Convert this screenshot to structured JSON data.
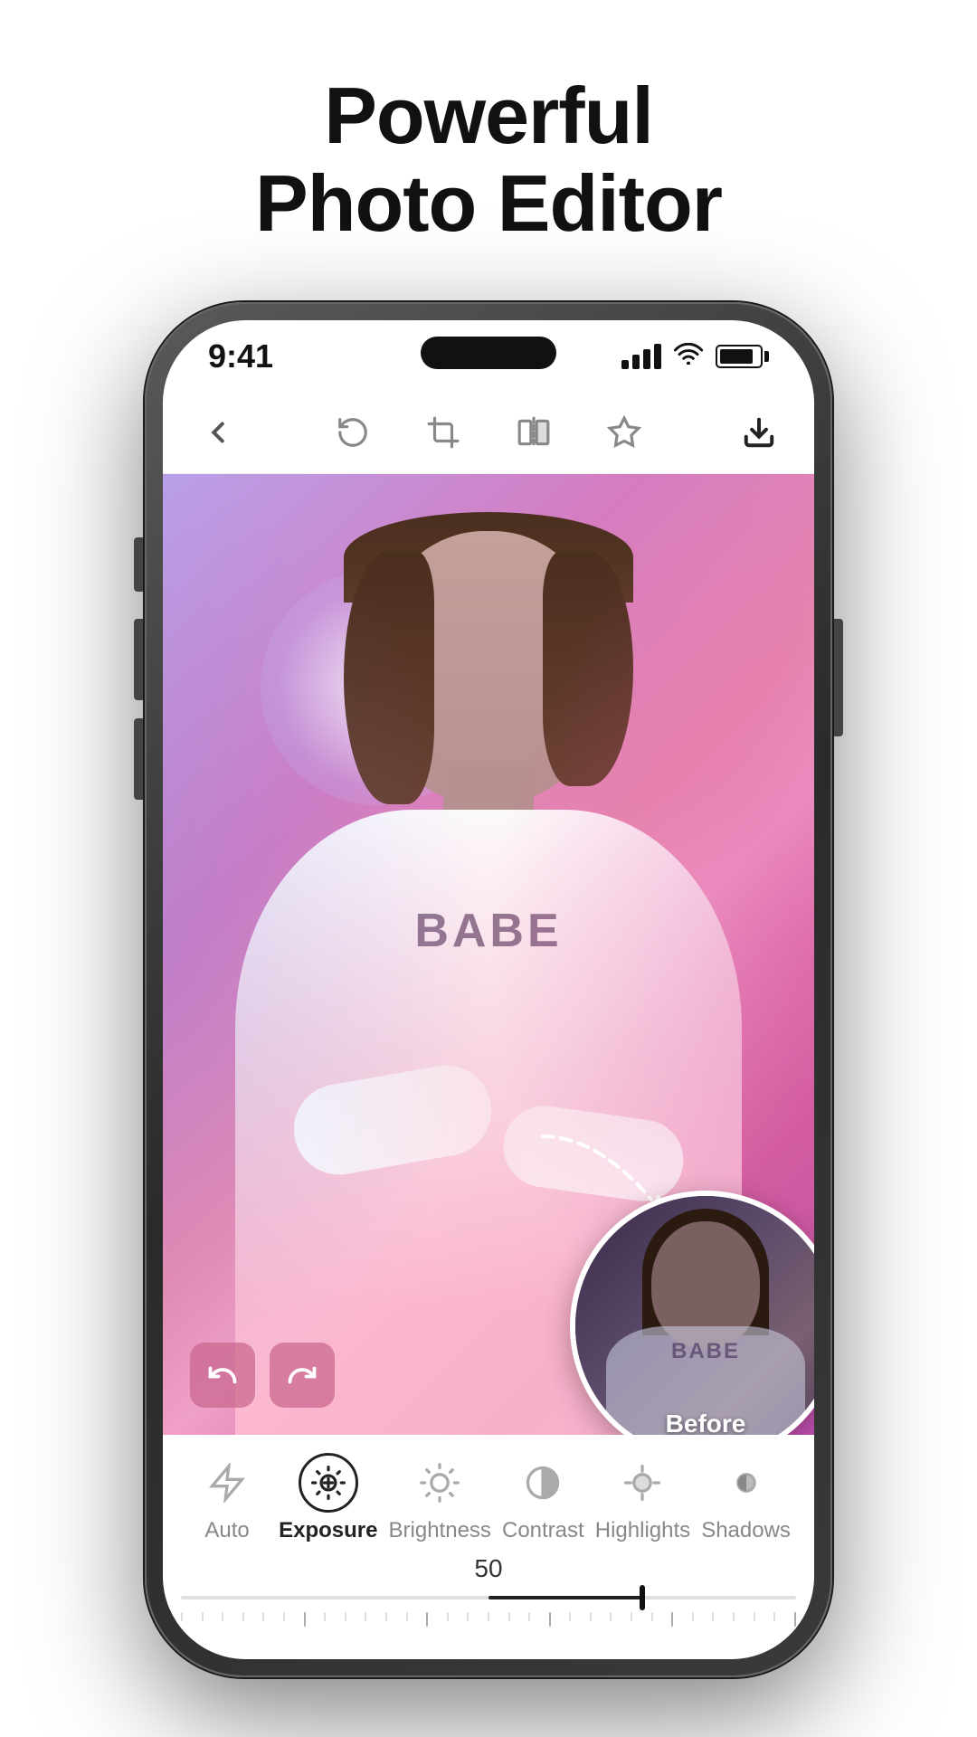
{
  "headline": {
    "line1": "Powerful",
    "line2": "Photo Editor"
  },
  "phone": {
    "status_bar": {
      "time": "9:41",
      "signal_bars": [
        12,
        18,
        24,
        30
      ],
      "wifi": "wifi",
      "battery_percent": 85
    },
    "toolbar": {
      "back_icon": "chevron-left",
      "rotate_icon": "rotate-ccw",
      "crop_icon": "crop",
      "flip_icon": "flip",
      "adjust_icon": "sliders",
      "download_icon": "download"
    },
    "before_label": "Before",
    "bottom_panel": {
      "slider_value": "50",
      "tools": [
        {
          "id": "auto",
          "label": "Auto",
          "active": false
        },
        {
          "id": "exposure",
          "label": "Exposure",
          "active": true
        },
        {
          "id": "brightness",
          "label": "Brightness",
          "active": false
        },
        {
          "id": "contrast",
          "label": "Contrast",
          "active": false
        },
        {
          "id": "highlights",
          "label": "Highlights",
          "active": false
        },
        {
          "id": "shadows",
          "label": "Shadows",
          "active": false
        }
      ]
    }
  },
  "colors": {
    "active_tool_color": "#222222",
    "inactive_tool_color": "#888888",
    "undo_bg": "rgba(200,100,140,0.7)",
    "photo_gradient_start": "#b8a0e8",
    "photo_gradient_end": "#c050b0"
  }
}
